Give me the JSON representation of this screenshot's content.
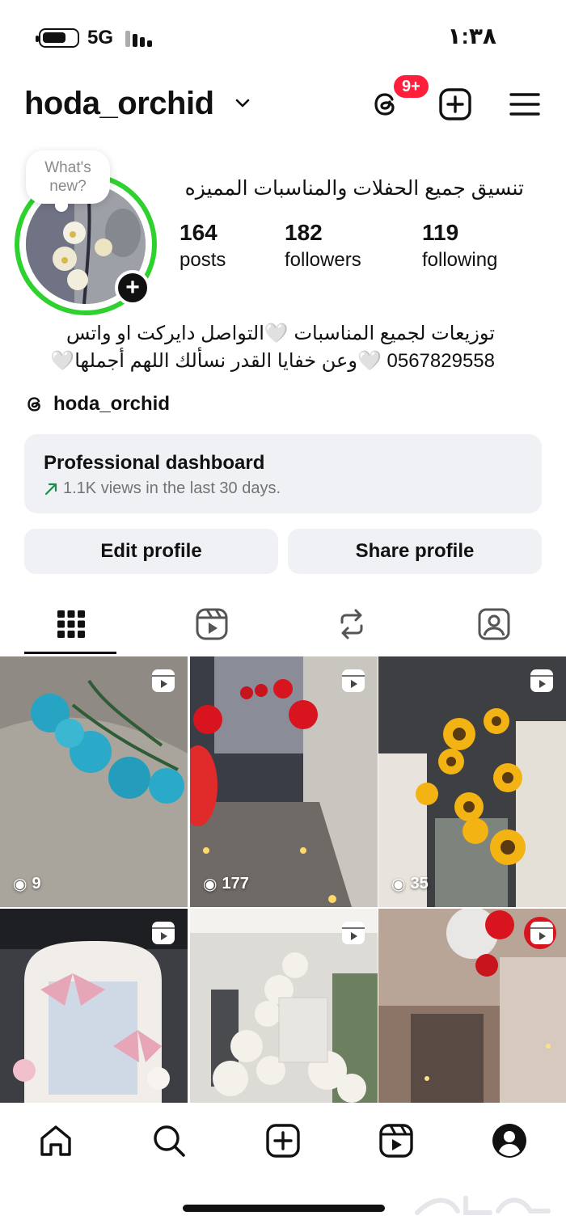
{
  "status_bar": {
    "network": "5G",
    "time": "١:٣٨",
    "battery_level": 0.6
  },
  "header": {
    "username": "hoda_orchid",
    "notification_badge": "9+"
  },
  "profile": {
    "note": "What's new?",
    "display_name": "تنسيق جميع الحفلات والمناسبات المميزه",
    "stats": [
      {
        "number": "164",
        "label": "posts"
      },
      {
        "number": "182",
        "label": "followers"
      },
      {
        "number": "119",
        "label": "following"
      }
    ],
    "bio_lines": [
      "توزيعات لجميع المناسبات 🤍التواصل دايركت او واتس",
      "0567829558 🤍وعن خفايا القدر نسألك اللهم أجملها🤍"
    ],
    "threads_handle": "hoda_orchid"
  },
  "dashboard": {
    "title": "Professional dashboard",
    "subtitle": "1.1K views in the last 30 days."
  },
  "buttons": {
    "edit": "Edit profile",
    "share": "Share profile"
  },
  "posts": [
    {
      "views": "9"
    },
    {
      "views": "177"
    },
    {
      "views": "35"
    },
    {
      "views": ""
    },
    {
      "views": ""
    },
    {
      "views": ""
    }
  ],
  "colors": {
    "story_ring": "#2fd12f",
    "badge": "#ff1f3d",
    "button_bg": "#eff1f4"
  }
}
